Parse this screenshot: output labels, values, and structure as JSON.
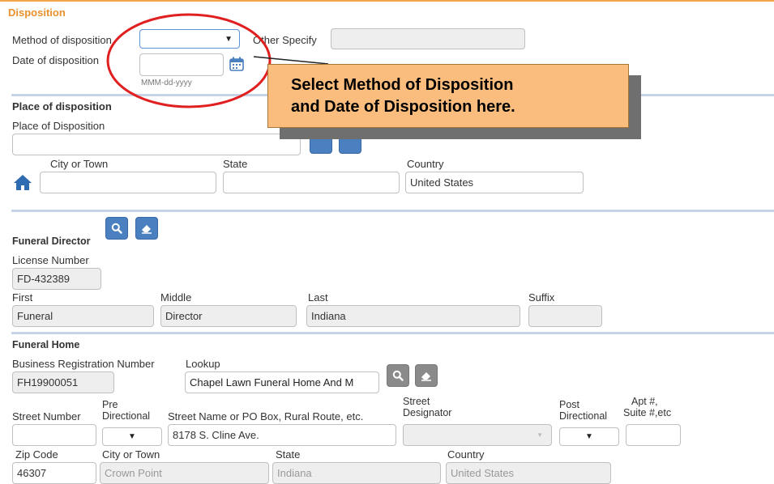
{
  "disposition": {
    "title": "Disposition",
    "method_label": "Method of disposition",
    "method_value": "",
    "other_specify_label": "Other Specify",
    "other_specify_value": "",
    "date_label": "Date of disposition",
    "date_value": "",
    "date_hint": "MMM-dd-yyyy"
  },
  "place": {
    "title": "Place of disposition",
    "place_label": "Place of Disposition",
    "place_value": "",
    "city_label": "City or Town",
    "city_value": "",
    "state_label": "State",
    "state_value": "",
    "country_label": "Country",
    "country_value": "United States"
  },
  "callout": {
    "line1": "Select Method of Disposition",
    "line2": "and Date of Disposition here."
  },
  "funeral_director": {
    "title": "Funeral Director",
    "license_label": "License Number",
    "license_value": "FD-432389",
    "first_label": "First",
    "first_value": "Funeral",
    "middle_label": "Middle",
    "middle_value": "Director",
    "last_label": "Last",
    "last_value": "Indiana",
    "suffix_label": "Suffix",
    "suffix_value": ""
  },
  "funeral_home": {
    "title": "Funeral Home",
    "brn_label": "Business Registration Number",
    "brn_value": "FH19900051",
    "lookup_label": "Lookup",
    "lookup_value": "Chapel Lawn Funeral Home And M",
    "street_number_label": "Street Number",
    "street_number_value": "",
    "pre_dir_label_1": "Pre",
    "pre_dir_label_2": "Directional",
    "street_name_label": "Street Name or PO Box, Rural Route, etc.",
    "street_name_value": "8178 S. Cline Ave.",
    "street_desig_label_1": "Street",
    "street_desig_label_2": "Designator",
    "post_dir_label_1": "Post",
    "post_dir_label_2": "Directional",
    "apt_label_1": "Apt #,",
    "apt_label_2": "Suite #,etc",
    "apt_value": "",
    "zip_label": "Zip Code",
    "zip_value": "46307",
    "city_label": "City or Town",
    "city_value": "Crown Point",
    "state_label": "State",
    "state_value": "Indiana",
    "country_label": "Country",
    "country_value": "United States"
  },
  "colors": {
    "section_title": "#e8922e",
    "button_blue": "#4a7fc0",
    "annotation_red": "#e02020",
    "callout_fill": "#fbbd7d"
  }
}
